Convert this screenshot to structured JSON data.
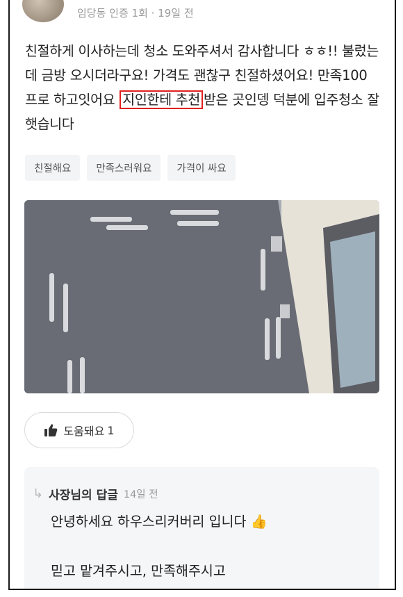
{
  "review": {
    "meta": "임당동 인증 1회 · 19일 전",
    "text_before": "친절하게 이사하는데 청소 도와주셔서 감사합니다 ㅎㅎ!! 불렀는데 금방 오시더라구요! 가격도 괜찮구 친절하셨어요! 만족100프로 하고잇어요 ",
    "text_highlight": "지인한테 추천",
    "text_after": "받은 곳인뎅 덕분에 입주청소 잘 햇습니다",
    "highlight_color": "#e0201f"
  },
  "tags": [
    "친절해요",
    "만족스러워요",
    "가격이 싸요"
  ],
  "photo": {
    "description_icon": "cleaning-photo"
  },
  "helpful": {
    "icon": "thumbs-up-icon",
    "label": "도움돼요",
    "count": "1"
  },
  "reply": {
    "owner": "사장님의 답글",
    "time": "14일 전",
    "line1": "안녕하세요 하우스리커버리 입니다",
    "emoji": "👍",
    "line2": "믿고 맡겨주시고, 만족해주시고"
  }
}
